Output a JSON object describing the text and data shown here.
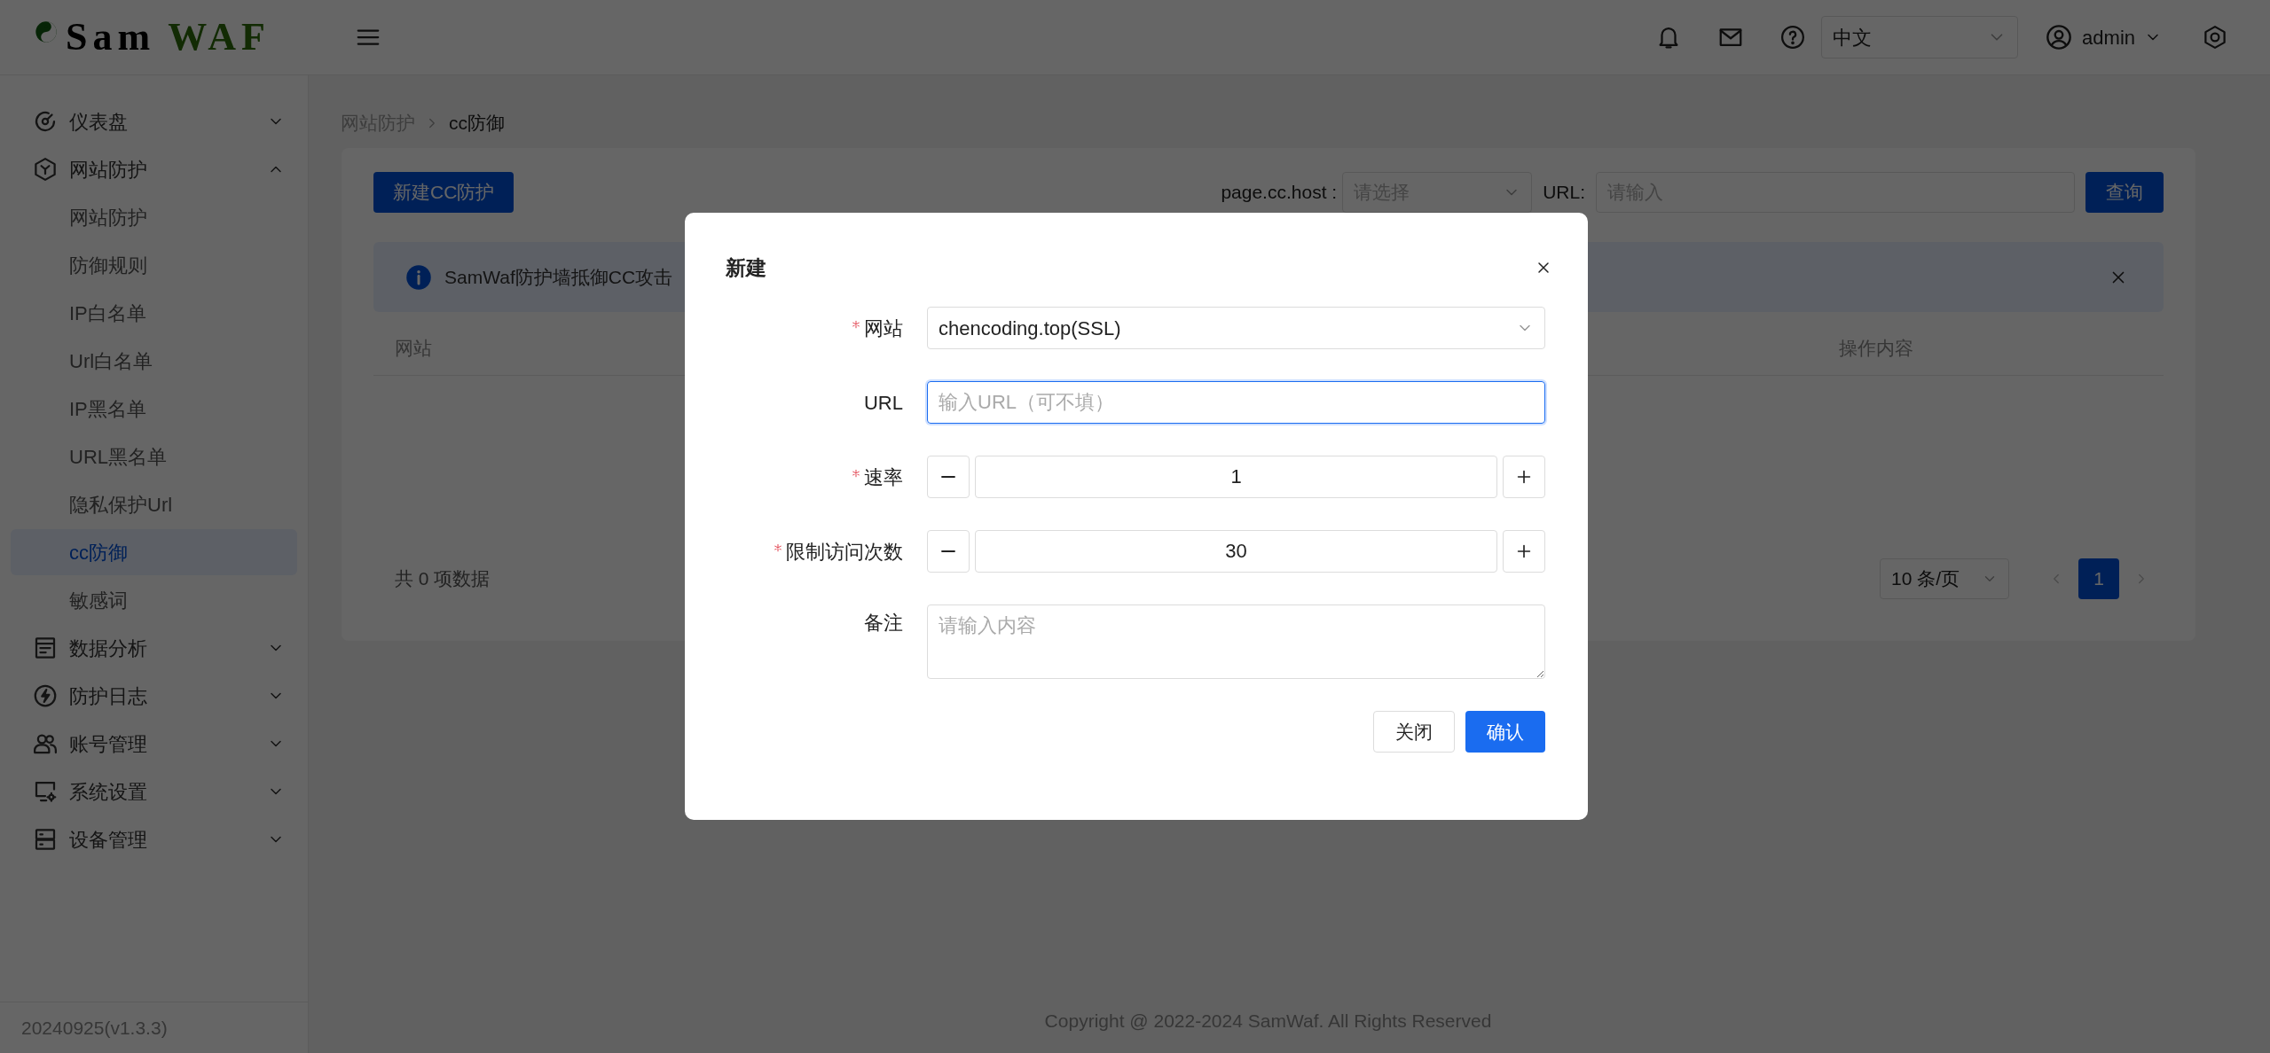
{
  "header": {
    "logo": [
      {
        "text": "Sam",
        "kind": "dark"
      },
      {
        "text": "WAF",
        "kind": "green"
      }
    ],
    "language": "中文",
    "user": "admin"
  },
  "sidebar": {
    "items": [
      {
        "label": "仪表盘",
        "expanded": false
      },
      {
        "label": "网站防护",
        "expanded": true,
        "children": [
          {
            "label": "网站防护",
            "selected": false
          },
          {
            "label": "防御规则",
            "selected": false
          },
          {
            "label": "IP白名单",
            "selected": false
          },
          {
            "label": "Url白名单",
            "selected": false
          },
          {
            "label": "IP黑名单",
            "selected": false
          },
          {
            "label": "URL黑名单",
            "selected": false
          },
          {
            "label": "隐私保护Url",
            "selected": false
          },
          {
            "label": "cc防御",
            "selected": true
          },
          {
            "label": "敏感词",
            "selected": false
          }
        ]
      },
      {
        "label": "数据分析",
        "expanded": false
      },
      {
        "label": "防护日志",
        "expanded": false
      },
      {
        "label": "账号管理",
        "expanded": false
      },
      {
        "label": "系统设置",
        "expanded": false
      },
      {
        "label": "设备管理",
        "expanded": false
      }
    ],
    "version": "20240925(v1.3.3)"
  },
  "breadcrumb": [
    {
      "label": "网站防护",
      "current": false
    },
    {
      "label": "cc防御",
      "current": true
    }
  ],
  "toolbar": {
    "new_button": "新建CC防护",
    "host_label": "page.cc.host :",
    "host_placeholder": "请选择",
    "url_label": "URL:",
    "url_placeholder": "请输入",
    "search_button": "查询"
  },
  "alert": "SamWaf防护墙抵御CC攻击",
  "table": {
    "columns": [
      "网站",
      "操作内容"
    ],
    "total": "共 0 项数据",
    "page_size": "10 条/页",
    "pages": [
      {
        "label": "1",
        "selected": true
      }
    ]
  },
  "footer": "Copyright @ 2022-2024 SamWaf. All Rights Reserved",
  "modal": {
    "title": "新建",
    "fields": [
      {
        "kind": "select",
        "label": "网站",
        "required": true,
        "focused": false,
        "value": "chencoding.top(SSL)"
      },
      {
        "kind": "input",
        "label": "URL",
        "required": false,
        "focused": true,
        "placeholder": "输入URL（可不填）"
      },
      {
        "kind": "stepper",
        "label": "速率",
        "required": true,
        "focused": false,
        "value": "1"
      },
      {
        "kind": "stepper",
        "label": "限制访问次数",
        "required": true,
        "focused": false,
        "value": "30"
      },
      {
        "kind": "textarea",
        "label": "备注",
        "required": false,
        "focused": false,
        "placeholder": "请输入内容"
      }
    ],
    "buttons": [
      {
        "label": "关闭",
        "primary": false
      },
      {
        "label": "确认",
        "primary": true
      }
    ]
  }
}
